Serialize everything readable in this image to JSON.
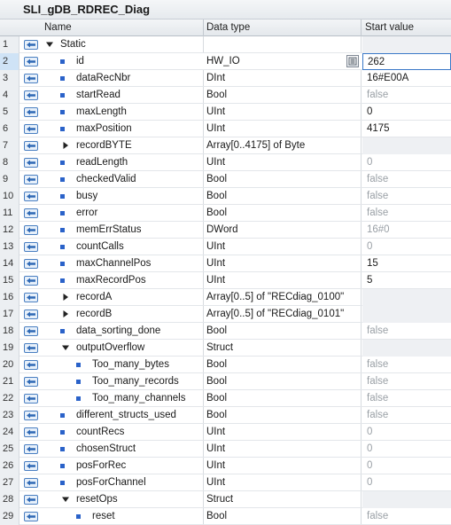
{
  "window": {
    "title": "SLI_gDB_RDREC_Diag"
  },
  "columns": {
    "name": "Name",
    "data_type": "Data type",
    "start_value": "Start value"
  },
  "icons": {
    "interface": "interface-arrow-icon",
    "expand": "expand-triangle-icon",
    "collapse": "collapse-triangle-icon",
    "leaf": "leaf-square-icon",
    "browse": "browse-list-icon"
  },
  "colors": {
    "accent": "#2a62c9",
    "selection": "#cfe3f6",
    "muted_text": "#9aa0a6"
  },
  "rows": [
    {
      "num": "1",
      "name": "Static",
      "type": "",
      "value": "",
      "level": 0,
      "toggle": "open",
      "gray": false,
      "shaded": true
    },
    {
      "num": "2",
      "name": "id",
      "type": "HW_IO",
      "value": "262",
      "level": 1,
      "toggle": "",
      "gray": false,
      "shaded": false,
      "selected": true,
      "editing": true
    },
    {
      "num": "3",
      "name": "dataRecNbr",
      "type": "DInt",
      "value": "16#E00A",
      "level": 1,
      "toggle": "",
      "gray": false,
      "shaded": false
    },
    {
      "num": "4",
      "name": "startRead",
      "type": "Bool",
      "value": "false",
      "level": 1,
      "toggle": "",
      "gray": true,
      "shaded": false
    },
    {
      "num": "5",
      "name": "maxLength",
      "type": "UInt",
      "value": "0",
      "level": 1,
      "toggle": "",
      "gray": false,
      "shaded": false
    },
    {
      "num": "6",
      "name": "maxPosition",
      "type": "UInt",
      "value": "4175",
      "level": 1,
      "toggle": "",
      "gray": false,
      "shaded": false
    },
    {
      "num": "7",
      "name": "recordBYTE",
      "type": "Array[0..4175] of Byte",
      "value": "",
      "level": 1,
      "toggle": "closed",
      "gray": false,
      "shaded": true
    },
    {
      "num": "8",
      "name": "readLength",
      "type": "UInt",
      "value": "0",
      "level": 1,
      "toggle": "",
      "gray": true,
      "shaded": false
    },
    {
      "num": "9",
      "name": "checkedValid",
      "type": "Bool",
      "value": "false",
      "level": 1,
      "toggle": "",
      "gray": true,
      "shaded": false
    },
    {
      "num": "10",
      "name": "busy",
      "type": "Bool",
      "value": "false",
      "level": 1,
      "toggle": "",
      "gray": true,
      "shaded": false
    },
    {
      "num": "11",
      "name": "error",
      "type": "Bool",
      "value": "false",
      "level": 1,
      "toggle": "",
      "gray": true,
      "shaded": false
    },
    {
      "num": "12",
      "name": "memErrStatus",
      "type": "DWord",
      "value": "16#0",
      "level": 1,
      "toggle": "",
      "gray": true,
      "shaded": false
    },
    {
      "num": "13",
      "name": "countCalls",
      "type": "UInt",
      "value": "0",
      "level": 1,
      "toggle": "",
      "gray": true,
      "shaded": false
    },
    {
      "num": "14",
      "name": "maxChannelPos",
      "type": "UInt",
      "value": "15",
      "level": 1,
      "toggle": "",
      "gray": false,
      "shaded": false
    },
    {
      "num": "15",
      "name": "maxRecordPos",
      "type": "UInt",
      "value": "5",
      "level": 1,
      "toggle": "",
      "gray": false,
      "shaded": false
    },
    {
      "num": "16",
      "name": "recordA",
      "type": "Array[0..5] of \"RECdiag_0100\"",
      "value": "",
      "level": 1,
      "toggle": "closed",
      "gray": false,
      "shaded": true
    },
    {
      "num": "17",
      "name": "recordB",
      "type": "Array[0..5] of \"RECdiag_0101\"",
      "value": "",
      "level": 1,
      "toggle": "closed",
      "gray": false,
      "shaded": true
    },
    {
      "num": "18",
      "name": "data_sorting_done",
      "type": "Bool",
      "value": "false",
      "level": 1,
      "toggle": "",
      "gray": true,
      "shaded": false
    },
    {
      "num": "19",
      "name": "outputOverflow",
      "type": "Struct",
      "value": "",
      "level": 1,
      "toggle": "open",
      "gray": false,
      "shaded": true
    },
    {
      "num": "20",
      "name": "Too_many_bytes",
      "type": "Bool",
      "value": "false",
      "level": 2,
      "toggle": "",
      "gray": true,
      "shaded": false
    },
    {
      "num": "21",
      "name": "Too_many_records",
      "type": "Bool",
      "value": "false",
      "level": 2,
      "toggle": "",
      "gray": true,
      "shaded": false
    },
    {
      "num": "22",
      "name": "Too_many_channels",
      "type": "Bool",
      "value": "false",
      "level": 2,
      "toggle": "",
      "gray": true,
      "shaded": false
    },
    {
      "num": "23",
      "name": "different_structs_used",
      "type": "Bool",
      "value": "false",
      "level": 1,
      "toggle": "",
      "gray": true,
      "shaded": false
    },
    {
      "num": "24",
      "name": "countRecs",
      "type": "UInt",
      "value": "0",
      "level": 1,
      "toggle": "",
      "gray": true,
      "shaded": false
    },
    {
      "num": "25",
      "name": "chosenStruct",
      "type": "UInt",
      "value": "0",
      "level": 1,
      "toggle": "",
      "gray": true,
      "shaded": false
    },
    {
      "num": "26",
      "name": "posForRec",
      "type": "UInt",
      "value": "0",
      "level": 1,
      "toggle": "",
      "gray": true,
      "shaded": false
    },
    {
      "num": "27",
      "name": "posForChannel",
      "type": "UInt",
      "value": "0",
      "level": 1,
      "toggle": "",
      "gray": true,
      "shaded": false
    },
    {
      "num": "28",
      "name": "resetOps",
      "type": "Struct",
      "value": "",
      "level": 1,
      "toggle": "open",
      "gray": false,
      "shaded": true
    },
    {
      "num": "29",
      "name": "reset",
      "type": "Bool",
      "value": "false",
      "level": 2,
      "toggle": "",
      "gray": true,
      "shaded": false
    }
  ]
}
